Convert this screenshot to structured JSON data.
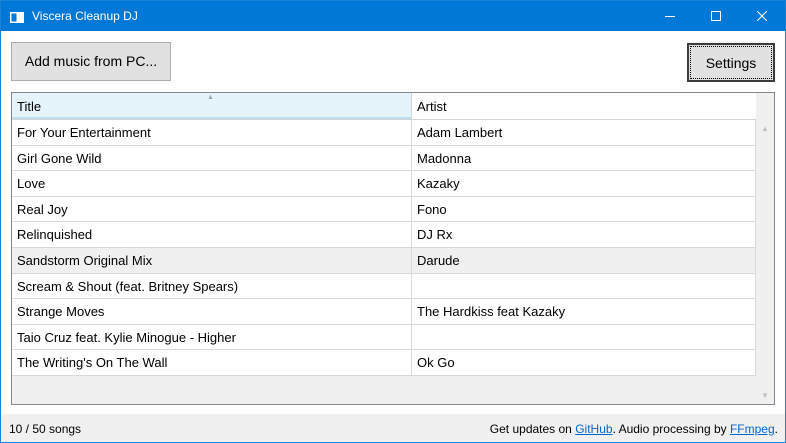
{
  "window": {
    "title": "Viscera Cleanup DJ",
    "accent": "#0078d7"
  },
  "toolbar": {
    "add_music_label": "Add music from PC...",
    "settings_label": "Settings"
  },
  "grid": {
    "columns": [
      "Title",
      "Artist"
    ],
    "sort_column": "Title",
    "rows": [
      {
        "title": "For Your Entertainment",
        "artist": "Adam Lambert"
      },
      {
        "title": "Girl Gone Wild",
        "artist": "Madonna"
      },
      {
        "title": "Love",
        "artist": "Kazaky"
      },
      {
        "title": "Real Joy",
        "artist": "Fono"
      },
      {
        "title": "Relinquished",
        "artist": "DJ Rx"
      },
      {
        "title": "Sandstorm Original Mix",
        "artist": "Darude"
      },
      {
        "title": "Scream & Shout (feat. Britney Spears)",
        "artist": ""
      },
      {
        "title": "Strange Moves",
        "artist": "The Hardkiss feat Kazaky"
      },
      {
        "title": "Taio Cruz feat. Kylie Minogue - Higher",
        "artist": ""
      },
      {
        "title": "The Writing's On The Wall",
        "artist": "Ok Go"
      }
    ],
    "selected_row": 5
  },
  "status": {
    "count": "10 / 50 songs",
    "updates_prefix": "Get updates on ",
    "github_link": "GitHub",
    "audio_text": ". Audio processing by ",
    "ffmpeg_link": "FFmpeg",
    "end": "."
  }
}
